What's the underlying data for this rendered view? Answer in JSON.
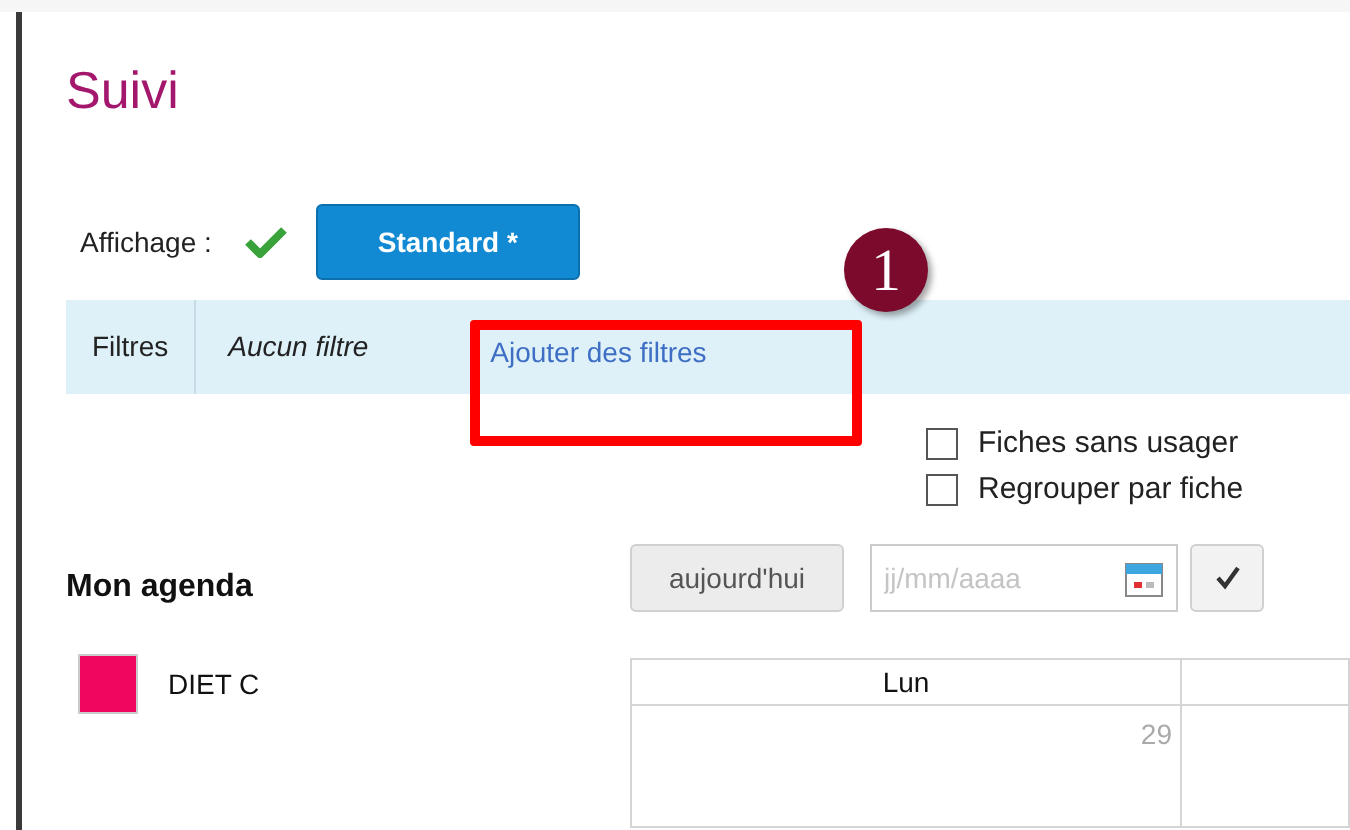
{
  "title": "Suivi",
  "display": {
    "label": "Affichage :",
    "view_button": "Standard *"
  },
  "filters": {
    "label": "Filtres",
    "value": "Aucun filtre",
    "add_link": "Ajouter des filtres"
  },
  "annotation": {
    "number": "1"
  },
  "options": [
    {
      "label": "Fiches sans usager",
      "checked": false
    },
    {
      "label": "Regrouper par fiche",
      "checked": false
    }
  ],
  "agenda": {
    "title": "Mon agenda",
    "today_button": "aujourd'hui",
    "date_field": {
      "placeholder": "jj/mm/aaaa"
    },
    "calendars": [
      {
        "name": "DIET C",
        "color": "#f0065f"
      }
    ],
    "columns": [
      {
        "day": "Lun",
        "date": "29"
      }
    ]
  }
}
